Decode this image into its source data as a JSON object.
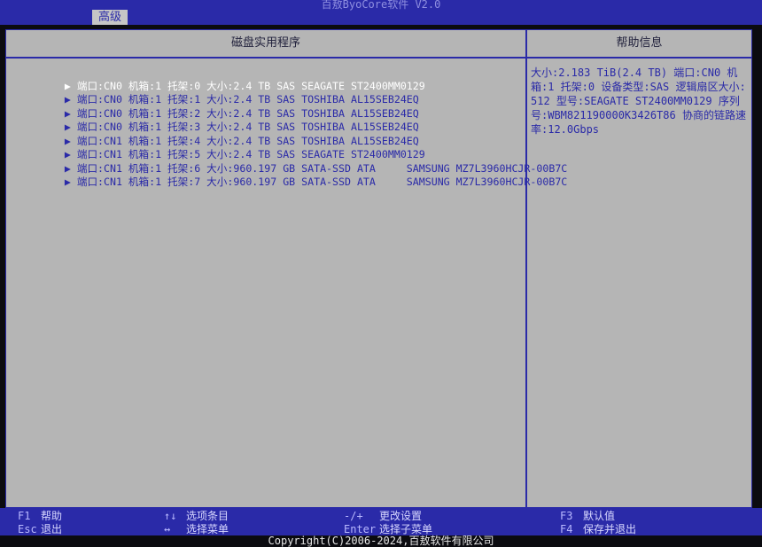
{
  "app": {
    "title": "百敖ByoCore软件 V2.0",
    "tab": "高级"
  },
  "left_panel": {
    "title": "磁盘实用程序",
    "items": [
      {
        "label": "端口:CN0 机箱:1 托架:0 大小:2.4 TB SAS SEAGATE ST2400MM0129"
      },
      {
        "label": "端口:CN0 机箱:1 托架:1 大小:2.4 TB SAS TOSHIBA AL15SEB24EQ"
      },
      {
        "label": "端口:CN0 机箱:1 托架:2 大小:2.4 TB SAS TOSHIBA AL15SEB24EQ"
      },
      {
        "label": "端口:CN0 机箱:1 托架:3 大小:2.4 TB SAS TOSHIBA AL15SEB24EQ"
      },
      {
        "label": "端口:CN1 机箱:1 托架:4 大小:2.4 TB SAS TOSHIBA AL15SEB24EQ"
      },
      {
        "label": "端口:CN1 机箱:1 托架:5 大小:2.4 TB SAS SEAGATE ST2400MM0129"
      },
      {
        "label": "端口:CN1 机箱:1 托架:6 大小:960.197 GB SATA-SSD ATA     SAMSUNG MZ7L3960HCJR-00B7C"
      },
      {
        "label": "端口:CN1 机箱:1 托架:7 大小:960.197 GB SATA-SSD ATA     SAMSUNG MZ7L3960HCJR-00B7C"
      }
    ]
  },
  "right_panel": {
    "title": "帮助信息",
    "text": "大小:2.183 TiB(2.4 TB) 端口:CN0 机箱:1 托架:0 设备类型:SAS 逻辑扇区大小:512 型号:SEAGATE ST2400MM0129 序列号:WBM821190000K3426T86 协商的链路速率:12.0Gbps"
  },
  "footer": {
    "keys": [
      {
        "key": "F1",
        "desc": "帮助"
      },
      {
        "key": "Esc",
        "desc": "退出"
      },
      {
        "key": "↑↓",
        "desc": "选项条目"
      },
      {
        "key": "↔",
        "desc": "选择菜单"
      },
      {
        "key": "-/+",
        "desc": "更改设置"
      },
      {
        "key": "Enter",
        "desc": "选择子菜单"
      },
      {
        "key": "F3",
        "desc": "默认值"
      },
      {
        "key": "F4",
        "desc": "保存并退出"
      }
    ],
    "copyright": "Copyright(C)2006-2024,百敖软件有限公司"
  },
  "colors": {
    "bar_blue": "#2a2aa8",
    "panel_gray": "#b5b5b5",
    "selected_text": "#ffffff"
  },
  "icons": {
    "submenu": "triangle-right-icon"
  }
}
